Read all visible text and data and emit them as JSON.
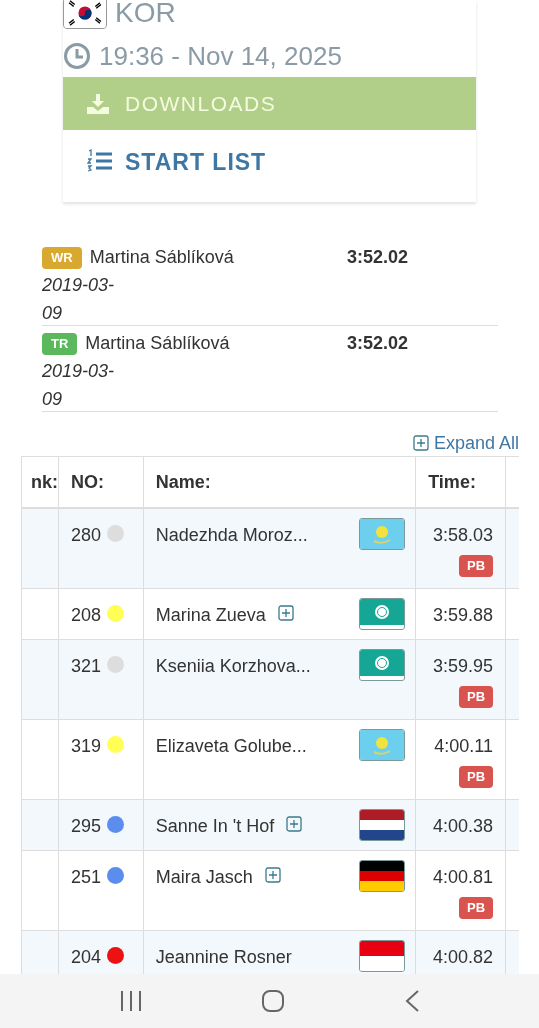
{
  "event": {
    "country": "KOR",
    "datetime": "19:36 - Nov 14, 2025",
    "downloads_button": "DOWNLOADS",
    "start_list_link": "START LIST"
  },
  "records": [
    {
      "badge": "WR",
      "color": "#d9a82e",
      "name": "Martina Sáblíková",
      "time": "3:52.02",
      "date": "2019-03-09"
    },
    {
      "badge": "TR",
      "color": "#5cb85c",
      "name": "Martina Sáblíková",
      "time": "3:52.02",
      "date": "2019-03-09"
    }
  ],
  "expand_all": "Expand All",
  "table": {
    "columns": [
      "nk:",
      "NO:",
      "Name:",
      "Time:"
    ],
    "rows": [
      {
        "no": "280",
        "color": "#dddddd",
        "name": "Nadezhda Moroz...",
        "expand_button": false,
        "flag": {
          "kind": "sun"
        },
        "time": "3:58.03",
        "badge": "PB"
      },
      {
        "no": "208",
        "color": "#ffff55",
        "name": "Marina Zueva",
        "expand_button": true,
        "flag": {
          "kind": "emblem"
        },
        "time": "3:59.88"
      },
      {
        "no": "321",
        "color": "#dddddd",
        "name": "Kseniia Korzhova...",
        "expand_button": false,
        "flag": {
          "kind": "emblem"
        },
        "time": "3:59.95",
        "badge": "PB"
      },
      {
        "no": "319",
        "color": "#ffff55",
        "name": "Elizaveta Golube...",
        "expand_button": false,
        "flag": {
          "kind": "sun"
        },
        "time": "4:00.11",
        "badge": "PB"
      },
      {
        "no": "295",
        "color": "#5b8def",
        "name": "Sanne In 't Hof",
        "expand_button": true,
        "flag": {
          "kind": "red-white-blue"
        },
        "time": "4:00.38"
      },
      {
        "no": "251",
        "color": "#5b8def",
        "name": "Maira Jasch",
        "expand_button": true,
        "flag": {
          "kind": "black-red-gold"
        },
        "time": "4:00.81",
        "badge": "PB"
      },
      {
        "no": "204",
        "color": "#ee1111",
        "name": "Jeannine Rosner",
        "expand_button": false,
        "flag": {
          "kind": "red-white"
        },
        "time": "4:00.82"
      }
    ]
  }
}
